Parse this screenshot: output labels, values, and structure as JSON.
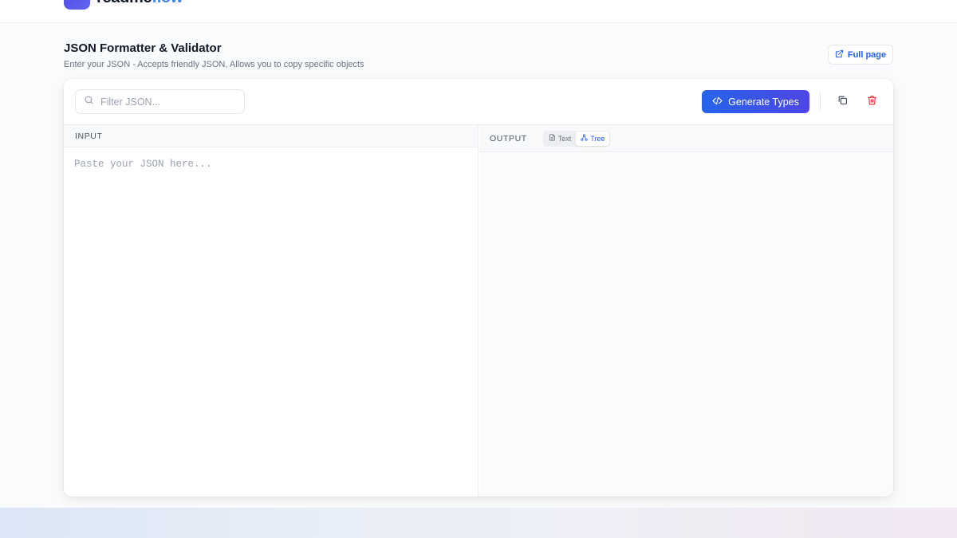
{
  "brand": {
    "name_part1": "readme",
    "name_part2": "flow"
  },
  "header": {
    "title": "JSON Formatter & Validator",
    "subtitle": "Enter your JSON - Accepts friendly JSON, Allows you to copy specific objects",
    "full_page_label": "Full page"
  },
  "toolbar": {
    "search_placeholder": "Filter JSON...",
    "generate_types_label": "Generate Types"
  },
  "input_pane": {
    "label": "INPUT",
    "placeholder": "Paste your JSON here..."
  },
  "output_pane": {
    "label": "OUTPUT",
    "view_modes": [
      {
        "label": "Text",
        "active": false
      },
      {
        "label": "Tree",
        "active": true
      }
    ]
  },
  "colors": {
    "accent": "#2563eb",
    "accent_gradient_end": "#4f46e5",
    "danger": "#dc2626"
  }
}
